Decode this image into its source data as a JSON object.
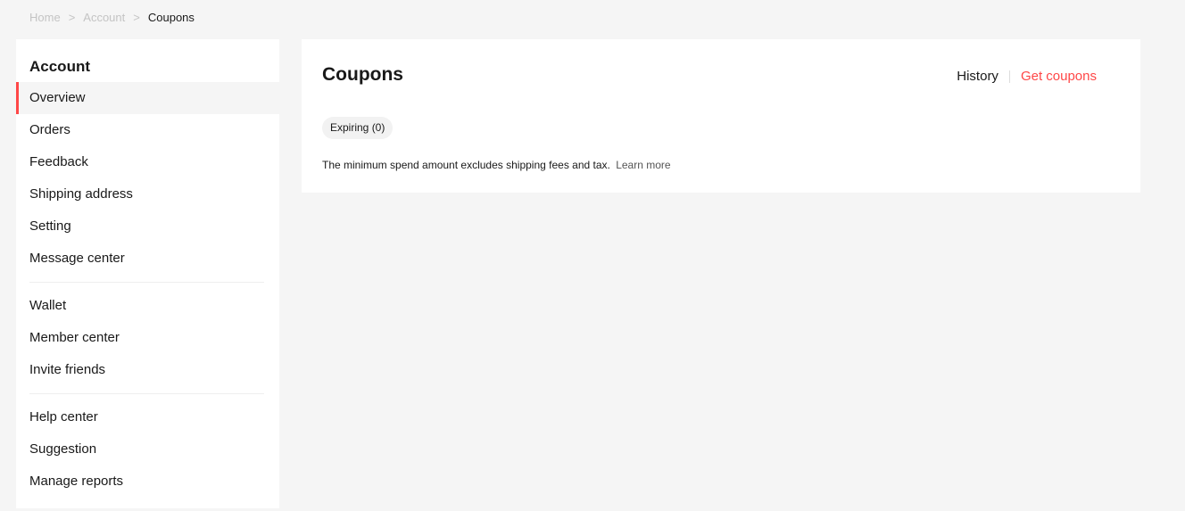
{
  "breadcrumb": {
    "items": [
      "Home",
      "Account",
      "Coupons"
    ],
    "separator": ">"
  },
  "sidebar": {
    "heading": "Account",
    "active_item": "Overview",
    "groups": [
      [
        "Overview",
        "Orders",
        "Feedback",
        "Shipping address",
        "Setting",
        "Message center"
      ],
      [
        "Wallet",
        "Member center",
        "Invite friends"
      ],
      [
        "Help center",
        "Suggestion",
        "Manage reports"
      ]
    ]
  },
  "main": {
    "title": "Coupons",
    "links": {
      "history": "History",
      "get_coupons": "Get coupons"
    },
    "filter": {
      "label": "Expiring (0)"
    },
    "note": {
      "text": "The minimum spend amount excludes shipping fees and tax.",
      "link": "Learn more"
    }
  },
  "colors": {
    "accent": "#ff4747",
    "background": "#f5f5f5",
    "card": "#ffffff",
    "text": "#191919",
    "muted": "#c4c4c4"
  }
}
